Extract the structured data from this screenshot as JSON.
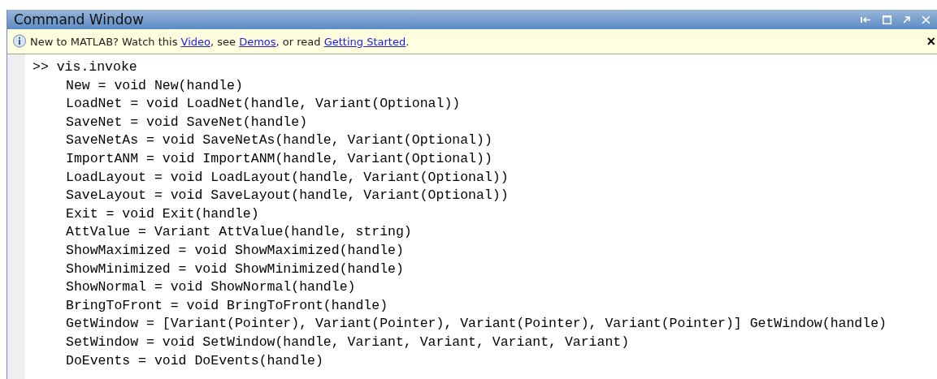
{
  "window": {
    "title": "Command Window"
  },
  "info_bar": {
    "parts": [
      {
        "kind": "text",
        "text": "New to MATLAB? Watch this "
      },
      {
        "kind": "link",
        "text": "Video"
      },
      {
        "kind": "text",
        "text": ", see "
      },
      {
        "kind": "link",
        "text": "Demos"
      },
      {
        "kind": "text",
        "text": ", or read "
      },
      {
        "kind": "link",
        "text": "Getting Started"
      },
      {
        "kind": "text",
        "text": "."
      }
    ],
    "close": "×"
  },
  "lines": [
    {
      "kind": "prompt",
      "text": ">> vis.invoke"
    },
    {
      "kind": "output",
      "text": "New = void New(handle)"
    },
    {
      "kind": "output",
      "text": "LoadNet = void LoadNet(handle, Variant(Optional))"
    },
    {
      "kind": "output",
      "text": "SaveNet = void SaveNet(handle)"
    },
    {
      "kind": "output",
      "text": "SaveNetAs = void SaveNetAs(handle, Variant(Optional))"
    },
    {
      "kind": "output",
      "text": "ImportANM = void ImportANM(handle, Variant(Optional))"
    },
    {
      "kind": "output",
      "text": "LoadLayout = void LoadLayout(handle, Variant(Optional))"
    },
    {
      "kind": "output",
      "text": "SaveLayout = void SaveLayout(handle, Variant(Optional))"
    },
    {
      "kind": "output",
      "text": "Exit = void Exit(handle)"
    },
    {
      "kind": "output",
      "text": "AttValue = Variant AttValue(handle, string)"
    },
    {
      "kind": "output",
      "text": "ShowMaximized = void ShowMaximized(handle)"
    },
    {
      "kind": "output",
      "text": "ShowMinimized = void ShowMinimized(handle)"
    },
    {
      "kind": "output",
      "text": "ShowNormal = void ShowNormal(handle)"
    },
    {
      "kind": "output",
      "text": "BringToFront = void BringToFront(handle)"
    },
    {
      "kind": "output",
      "text": "GetWindow = [Variant(Pointer), Variant(Pointer), Variant(Pointer), Variant(Pointer)] GetWindow(handle)"
    },
    {
      "kind": "output",
      "text": "SetWindow = void SetWindow(handle, Variant, Variant, Variant, Variant)"
    },
    {
      "kind": "output",
      "text": "DoEvents = void DoEvents(handle)"
    }
  ]
}
